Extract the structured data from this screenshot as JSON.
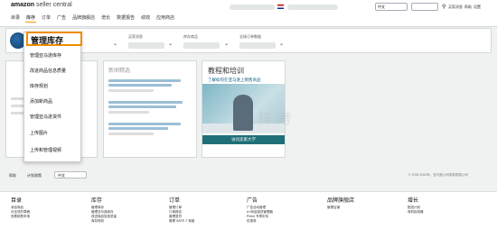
{
  "header": {
    "logo_brand": "amazon",
    "logo_product": "seller central",
    "nav": [
      "目录",
      "库存",
      "订单",
      "广告",
      "品牌旗舰店",
      "增长",
      "数据报告",
      "绩效",
      "应用商店"
    ],
    "active_nav": "库存",
    "lang_value": "中文",
    "top_links": [
      "买家消息",
      "帮助",
      "设置"
    ]
  },
  "widgets": {
    "labels": [
      "买家消息",
      "库存商品",
      "全球订单数据"
    ]
  },
  "inventory_menu": {
    "title": "管理库存",
    "items": [
      "管理亚马逊库存",
      "改进商品信息质量",
      "库存规划",
      "添加新商品",
      "管理亚马逊货件",
      "上传图片",
      "上传和管理视频"
    ]
  },
  "cards": {
    "card2_title": "新闻精选",
    "learning_title": "教程和培训",
    "learning_subtitle": "了解如何在亚马逊上销售商品",
    "learning_button": "访问卖家大学"
  },
  "watermark": "梓 考",
  "filterbar": {
    "help": "帮助",
    "plan": "计划政策",
    "lang": "中文",
    "copyright": "© 1999-2020年，亚马逊公司或其附属公司"
  },
  "footer": {
    "columns": [
      {
        "title": "目录",
        "items": [
          "添加商品",
          "补全您的草稿",
          "查看销售申请"
        ]
      },
      {
        "title": "库存",
        "items": [
          "管理库存",
          "管理亚马逊库存",
          "改进商品信息质量",
          "库存规划"
        ]
      },
      {
        "title": "订单",
        "items": [
          "管理订单",
          "订单报告",
          "管理退货",
          "管理 SAFE-T 索赔"
        ]
      },
      {
        "title": "广告",
        "items": [
          "广告活动管理",
          "A+商品描述管理器",
          "Prime 专享折扣",
          "优惠券"
        ]
      },
      {
        "title": "品牌旗舰店",
        "items": [
          "管理店铺"
        ]
      },
      {
        "title": "增长",
        "items": [
          "配送计划",
          "商机探测器"
        ]
      }
    ]
  },
  "colors": {
    "accent_orange": "#f08c00",
    "learn_button": "#1f6f79"
  }
}
